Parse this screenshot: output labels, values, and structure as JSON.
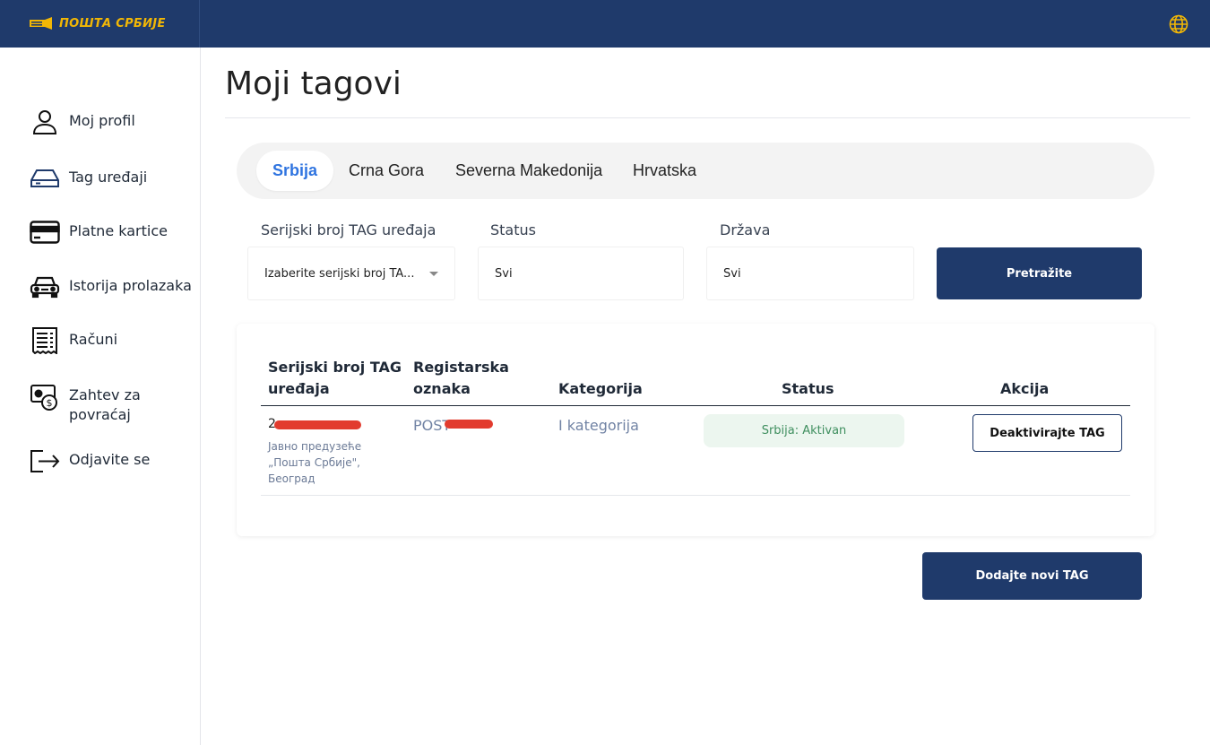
{
  "header": {
    "logo_text": "ПОШТА СРБИЈЕ",
    "language_icon": "globe-icon",
    "brand_color": "#1f3a6b",
    "logo_color": "#f2b705"
  },
  "sidebar": {
    "items": [
      {
        "label": "Moj profil",
        "icon": "user-icon"
      },
      {
        "label": "Tag uređaji",
        "icon": "tag-device-icon"
      },
      {
        "label": "Platne kartice",
        "icon": "credit-card-icon"
      },
      {
        "label": "Istorija prolazaka",
        "icon": "car-icon"
      },
      {
        "label": "Računi",
        "icon": "receipt-icon"
      },
      {
        "label": "Zahtev za povraćaj",
        "icon": "refund-icon"
      },
      {
        "label": "Odjavite se",
        "icon": "logout-icon"
      }
    ]
  },
  "main": {
    "title": "Moji tagovi",
    "tabs": [
      {
        "label": "Srbija",
        "active": true
      },
      {
        "label": "Crna Gora",
        "active": false
      },
      {
        "label": "Severna Makedonija",
        "active": false
      },
      {
        "label": "Hrvatska",
        "active": false
      }
    ],
    "filters": {
      "serial_label": "Serijski broj TAG uređaja",
      "serial_value": "Izaberite serijski broj TA...",
      "status_label": "Status",
      "status_value": "Svi",
      "country_label": "Država",
      "country_value": "Svi",
      "search_button": "Pretražite"
    },
    "table": {
      "headers": {
        "serial_line1": "Serijski broj TAG",
        "serial_line2": "uređaja",
        "plate_line1": "Registarska",
        "plate_line2": "oznaka",
        "category": "Kategorija",
        "status": "Status",
        "action": "Akcija"
      },
      "rows": [
        {
          "serial_prefix": "2",
          "issuer_line1": "Јавно предузеће",
          "issuer_line2": "„Пошта Србије\",",
          "issuer_line3": "Београд",
          "plate_prefix": "POST",
          "category": "I kategorija",
          "status": "Srbija: Aktivan",
          "action": "Deaktivirajte TAG"
        }
      ]
    },
    "add_button": "Dodajte novi TAG"
  }
}
